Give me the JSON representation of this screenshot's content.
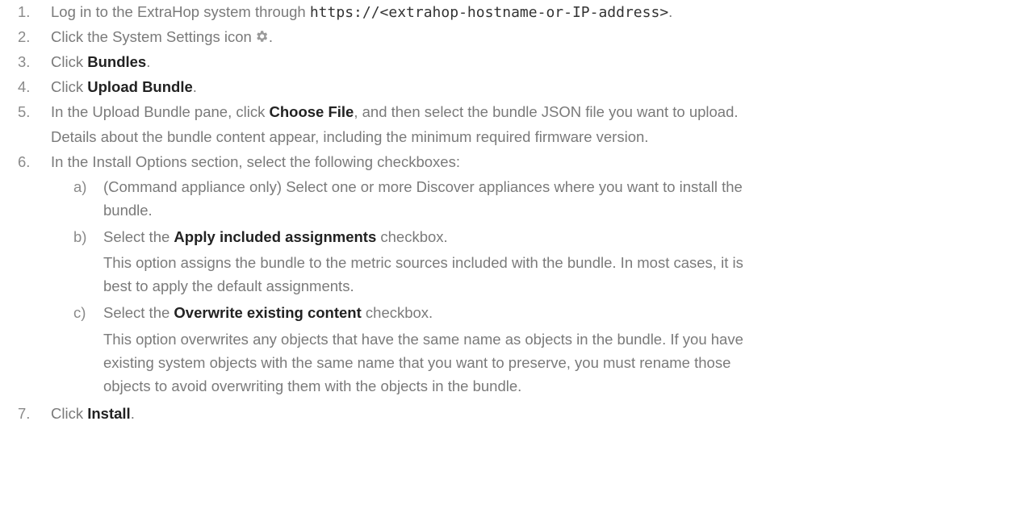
{
  "steps": [
    {
      "num": "1.",
      "pre": "Log in to the ExtraHop system through ",
      "code": "https://<extrahop-hostname-or-IP-address>",
      "post": "."
    },
    {
      "num": "2.",
      "pre": "Click the System Settings icon",
      "post": ".",
      "icon": "gear-icon"
    },
    {
      "num": "3.",
      "pre": "Click ",
      "bold": "Bundles",
      "post": "."
    },
    {
      "num": "4.",
      "pre": "Click ",
      "bold": "Upload Bundle",
      "post": "."
    },
    {
      "num": "5.",
      "pre": "In the Upload Bundle pane, click ",
      "bold": "Choose File",
      "post": ", and then select the bundle JSON file you want to upload.",
      "note": "Details about the bundle content appear, including the minimum required firmware version."
    },
    {
      "num": "6.",
      "pre": "In the Install Options section, select the following checkboxes:"
    },
    {
      "num": "7.",
      "pre": "Click ",
      "bold": "Install",
      "post": "."
    }
  ],
  "substeps": [
    {
      "num": "a)",
      "line1": "(Command appliance only) Select one or more Discover appliances where you want to install the",
      "line2": "bundle."
    },
    {
      "num": "b)",
      "pre": "Select the ",
      "bold": "Apply included assignments",
      "post": " checkbox.",
      "note1": "This option assigns the bundle to the metric sources included with the bundle. In most cases, it is",
      "note2": "best to apply the default assignments."
    },
    {
      "num": "c)",
      "pre": "Select the ",
      "bold": "Overwrite existing content",
      "post": " checkbox.",
      "note1": "This option overwrites any objects that have the same name as objects in the bundle. If you have",
      "note2": "existing system objects with the same name that you want to preserve, you must rename those",
      "note3": "objects to avoid overwriting them with the objects in the bundle."
    }
  ]
}
